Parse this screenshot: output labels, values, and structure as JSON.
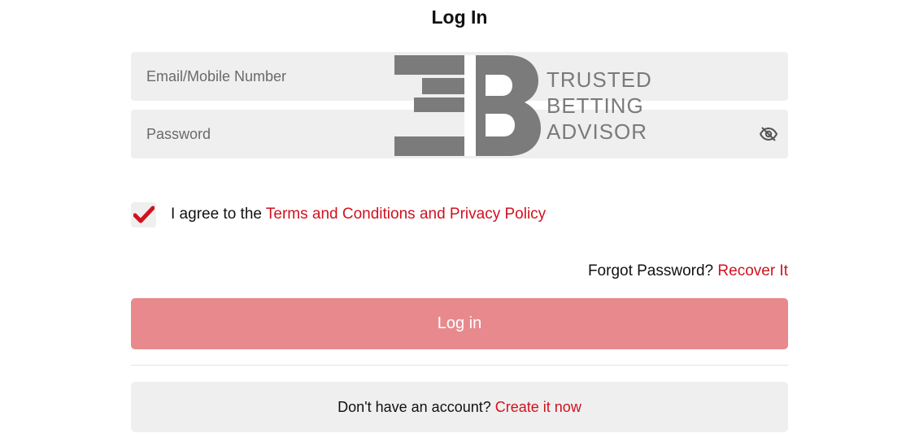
{
  "header": {
    "title": "Log In"
  },
  "form": {
    "email_placeholder": "Email/Mobile Number",
    "password_placeholder": "Password",
    "agree_text": "I agree to the ",
    "agree_link": "Terms and Conditions and Privacy Policy",
    "agree_checked": true,
    "forgot_text": "Forgot Password? ",
    "forgot_link": "Recover It",
    "login_label": "Log in"
  },
  "signup": {
    "text": "Don't have an account? ",
    "link": "Create it now"
  },
  "watermark": {
    "line1": "TRUSTED",
    "line2": "BETTING",
    "line3": "ADVISOR"
  },
  "icons": {
    "password_toggle": "eye-slash-icon",
    "checkmark": "checkmark-icon",
    "logo": "tba-logo-icon"
  },
  "colors": {
    "accent": "#d0121f",
    "button_disabled": "#e88a8d",
    "field_bg": "#efefef"
  }
}
